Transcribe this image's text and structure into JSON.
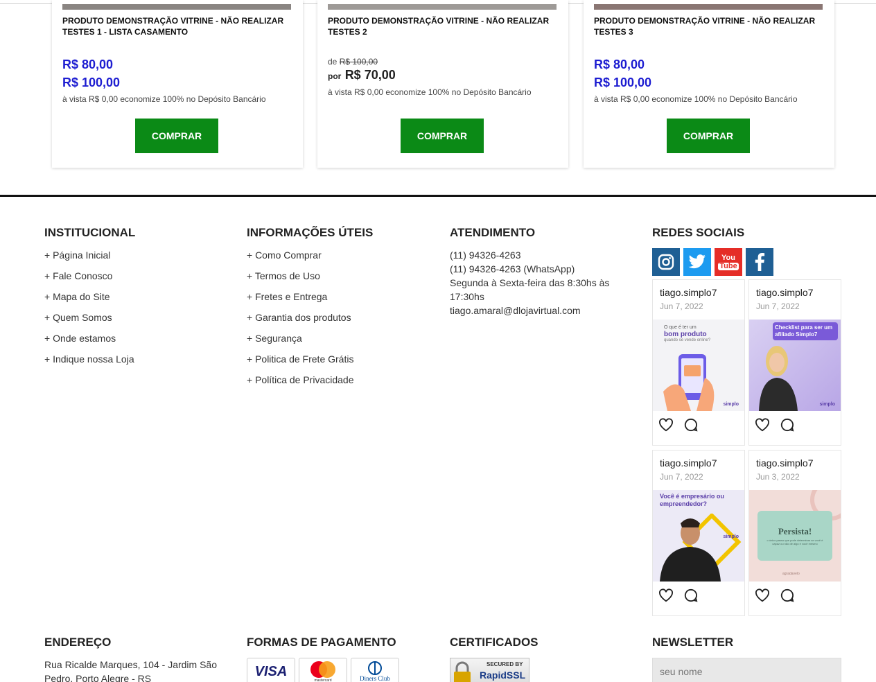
{
  "products": [
    {
      "title": "PRODUTO DEMONSTRAÇÃO VITRINE - NÃO REALIZAR TESTES 1 - LISTA CASAMENTO",
      "price1": "R$ 80,00",
      "price2": "R$ 100,00",
      "cash_note": "à vista R$ 0,00 economize 100% no Depósito Bancário",
      "buy_label": "COMPRAR"
    },
    {
      "title": "PRODUTO DEMONSTRAÇÃO VITRINE - NÃO REALIZAR TESTES 2",
      "de_label": "de",
      "old_price": "R$ 100,00",
      "por_label": "por",
      "new_price": "R$ 70,00",
      "cash_note": "à vista R$ 0,00 economize 100% no Depósito Bancário",
      "buy_label": "COMPRAR"
    },
    {
      "title": "PRODUTO DEMONSTRAÇÃO VITRINE - NÃO REALIZAR TESTES 3",
      "price1": "R$ 80,00",
      "price2": "R$ 100,00",
      "cash_note": "à vista R$ 0,00 economize 100% no Depósito Bancário",
      "buy_label": "COMPRAR"
    }
  ],
  "footer": {
    "institucional": {
      "title": "INSTITUCIONAL",
      "links": [
        "+ Página Inicial",
        "+ Fale Conosco",
        "+ Mapa do Site",
        "+ Quem Somos",
        "+ Onde estamos",
        "+ Indique nossa Loja"
      ]
    },
    "informacoes": {
      "title": "INFORMAÇÕES ÚTEIS",
      "links": [
        "+ Como Comprar",
        "+ Termos de Uso",
        "+ Fretes e Entrega",
        "+ Garantia dos produtos",
        "+ Segurança",
        "+ Politica de Frete Grátis",
        "+ Política de Privacidade"
      ]
    },
    "atendimento": {
      "title": "ATENDIMENTO",
      "phone": "(11) 94326-4263",
      "whatsapp": "(11) 94326-4263 (WhatsApp)",
      "hours": "Segunda à Sexta-feira das 8:30hs às 17:30hs",
      "email": "tiago.amaral@dlojavirtual.com"
    },
    "redes": {
      "title": "REDES SOCIAIS",
      "icons": [
        "instagram-icon",
        "twitter-icon",
        "youtube-icon",
        "facebook-icon"
      ],
      "youtube_text_top": "You",
      "youtube_text_bottom": "Tube",
      "posts": [
        {
          "user": "tiago.simplo7",
          "date": "Jun 7, 2022",
          "caption_small": "O que é ter um",
          "caption_big": "bom produto",
          "caption_sub": "quando se vende online?",
          "brand": "simplo"
        },
        {
          "user": "tiago.simplo7",
          "date": "Jun 7, 2022",
          "caption_big": "Checklist para ser um afiliado Simplo7",
          "brand": "simplo"
        },
        {
          "user": "tiago.simplo7",
          "date": "Jun 7, 2022",
          "caption_big": "Você é empresário ou empreendedor?",
          "brand": "simplo"
        },
        {
          "user": "tiago.simplo7",
          "date": "Jun 3, 2022",
          "caption_big": "Persista!",
          "caption_sub": "o único passo que pode determinar se você é capaz ou não de algo é você mesmo",
          "brand": "agradavelo"
        }
      ]
    },
    "endereco": {
      "title": "ENDEREÇO",
      "address": "Rua Ricalde Marques, 104 - Jardim São Pedro, Porto Alegre - RS"
    },
    "pagamento": {
      "title": "FORMAS DE PAGAMENTO",
      "cards": [
        "VISA",
        "mastercard",
        "Diners Club"
      ]
    },
    "certificados": {
      "title": "CERTIFICADOS",
      "badge_top": "SECURED BY",
      "badge_main": "RapidSSL"
    },
    "newsletter": {
      "title": "NEWSLETTER",
      "name_placeholder": "seu nome"
    }
  },
  "colors": {
    "buy_button": "#0b8a16",
    "price_blue": "#1d1dd1",
    "divider": "#111111"
  }
}
